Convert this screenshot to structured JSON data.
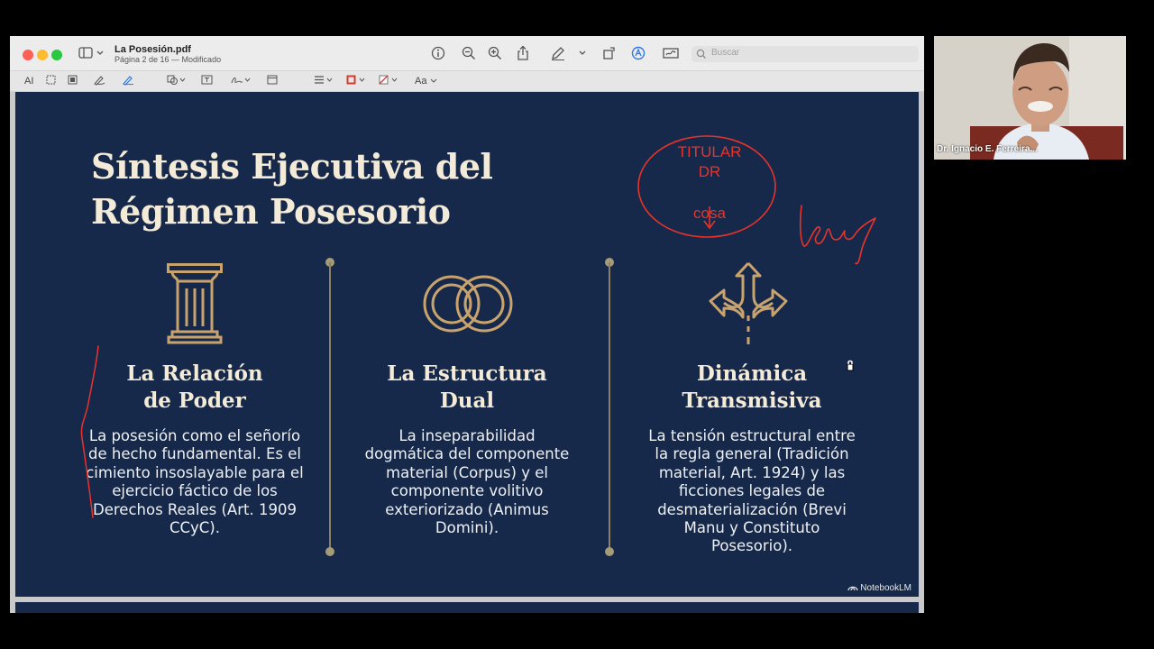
{
  "window": {
    "doc_title": "La Posesión.pdf",
    "doc_subtitle": "Página 2 de 16 — Modificado",
    "search_placeholder": "Buscar"
  },
  "toolbar2": {
    "text_label": "AI",
    "font_label": "Aa"
  },
  "slide": {
    "title_line1": "Síntesis Ejecutiva del",
    "title_line2": "Régimen Posesorio",
    "columns": [
      {
        "title_line1": "La Relación",
        "title_line2": "de Poder",
        "body": [
          "La posesión como el señorío",
          "de hecho fundamental. Es el",
          "cimiento insoslayable para el",
          "ejercicio fáctico de los",
          "Derechos Reales (Art. 1909",
          "CCyC)."
        ]
      },
      {
        "title_line1": "La Estructura",
        "title_line2": "Dual",
        "body": [
          "La inseparabilidad",
          "dogmática del componente",
          "material (Corpus) y el",
          "componente volitivo",
          "exteriorizado (Animus",
          "Domini)."
        ]
      },
      {
        "title_line1": "Dinámica",
        "title_line2": "Transmisiva",
        "body": [
          "La tensión estructural entre",
          "la regla general (Tradición",
          "material, Art. 1924) y las",
          "ficciones legales de",
          "desmaterialización (Brevi",
          "Manu y Constituto",
          "Posesorio)."
        ]
      }
    ],
    "annotation": {
      "line1": "TITULAR",
      "line2": "DR",
      "line3": "cosa",
      "handwriting": "ley"
    },
    "watermark": "NotebookLM",
    "accent_color": "#16294a",
    "text_color": "#f3ead8",
    "ink_color": "#e8332a"
  },
  "webcam": {
    "participant_name": "Dr. Ignacio E. Ferreira..."
  }
}
